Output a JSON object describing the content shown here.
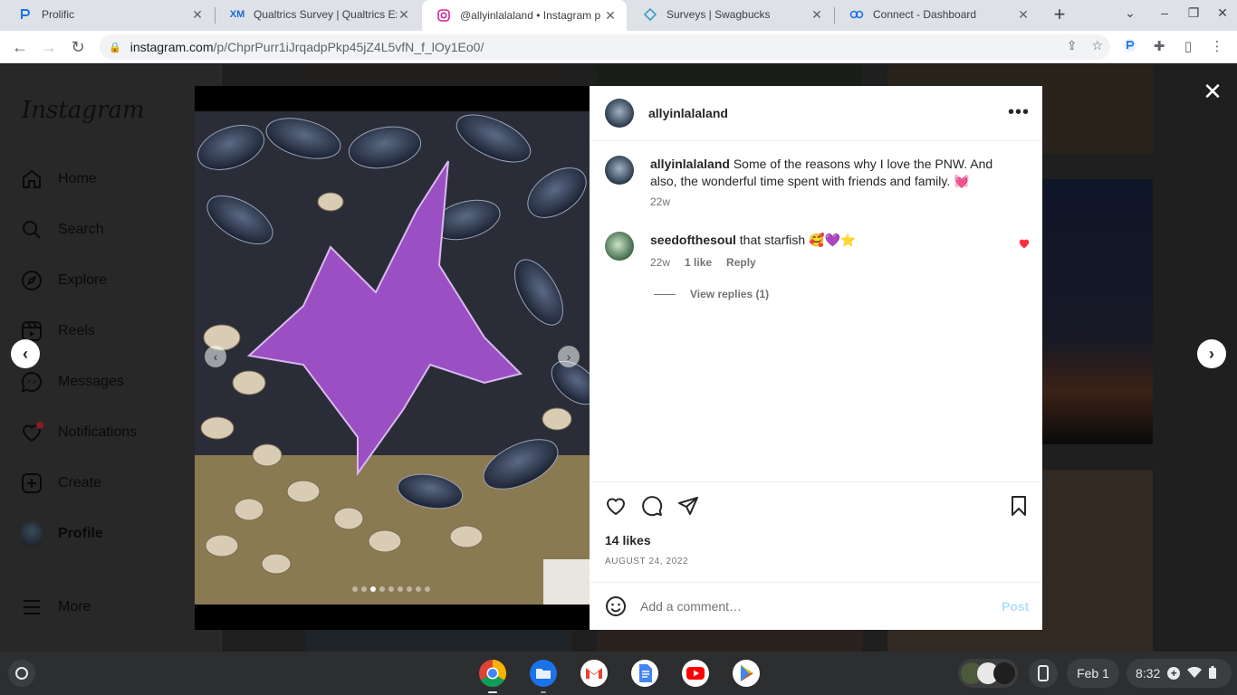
{
  "browser": {
    "tabs": [
      {
        "title": "Prolific",
        "icon": "prolific-icon"
      },
      {
        "title": "Qualtrics Survey | Qualtrics Exp",
        "icon": "qualtrics-icon",
        "badge": "XM"
      },
      {
        "title": "@allyinlalaland • Instagram p",
        "icon": "instagram-icon",
        "active": true
      },
      {
        "title": "Surveys | Swagbucks",
        "icon": "swagbucks-icon"
      },
      {
        "title": "Connect - Dashboard",
        "icon": "connect-icon"
      }
    ],
    "url_host": "instagram.com",
    "url_path": "/p/ChprPurr1iJrqadpPkp45jZ4L5vfN_f_lOy1Eo0/"
  },
  "instagram": {
    "brand": "Instagram",
    "nav": [
      {
        "label": "Home",
        "icon": "home-icon"
      },
      {
        "label": "Search",
        "icon": "search-icon"
      },
      {
        "label": "Explore",
        "icon": "explore-icon"
      },
      {
        "label": "Reels",
        "icon": "reels-icon"
      },
      {
        "label": "Messages",
        "icon": "messages-icon"
      },
      {
        "label": "Notifications",
        "icon": "heart-icon"
      },
      {
        "label": "Create",
        "icon": "create-icon"
      },
      {
        "label": "Profile",
        "icon": "avatar"
      },
      {
        "label": "More",
        "icon": "menu-icon"
      }
    ]
  },
  "post": {
    "username": "allyinlalaland",
    "caption_user": "allyinlalaland",
    "caption_text": "Some of the reasons why I love the PNW. And also, the wonderful time spent with friends and family. 💓",
    "caption_age": "22w",
    "comments": [
      {
        "user": "seedofthesoul",
        "text": "that starfish 🥰💜⭐",
        "age": "22w",
        "likes": "1 like",
        "reply": "Reply",
        "view_replies": "View replies (1)"
      }
    ],
    "likes": "14 likes",
    "date": "AUGUST 24, 2022",
    "comment_placeholder": "Add a comment…",
    "post_label": "Post",
    "carousel": {
      "count": 9,
      "current": 3
    }
  },
  "shelf": {
    "apps": [
      "chrome-icon",
      "files-icon",
      "gmail-icon",
      "docs-icon",
      "youtube-icon",
      "play-store-icon"
    ],
    "date": "Feb 1",
    "time": "8:32"
  },
  "colors": {
    "accent": "#0095f6",
    "like_red": "#ff3040",
    "post_disabled": "#b2dffc"
  }
}
